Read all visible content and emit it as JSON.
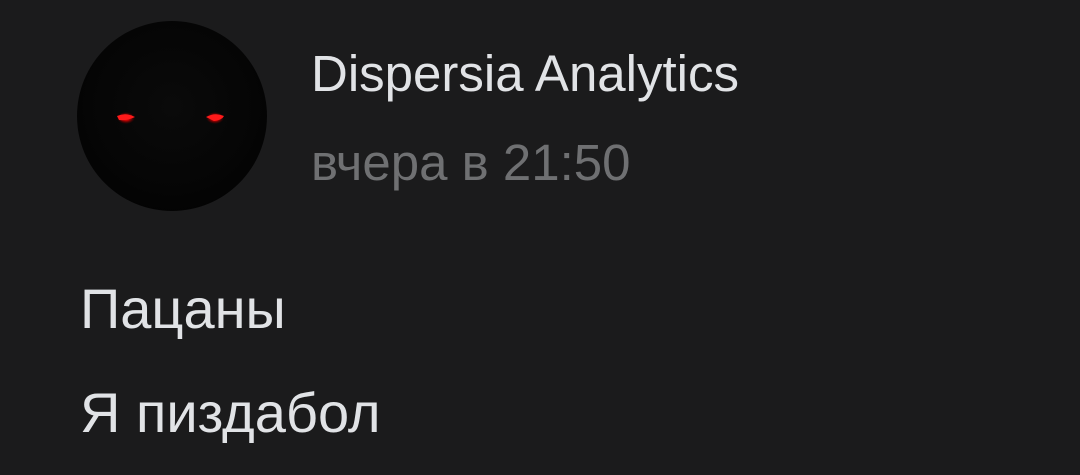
{
  "post": {
    "author": "Dispersia Analytics",
    "timestamp": "вчера в 21:50",
    "avatar_icon": "red-glowing-eyes-avatar",
    "text_lines": [
      "Пацаны",
      "Я пиздабол"
    ]
  },
  "colors": {
    "background": "#1b1b1c",
    "primary_text": "#e1e3e6",
    "secondary_text": "#6f7072",
    "eye_glow": "#ff1a1a"
  }
}
